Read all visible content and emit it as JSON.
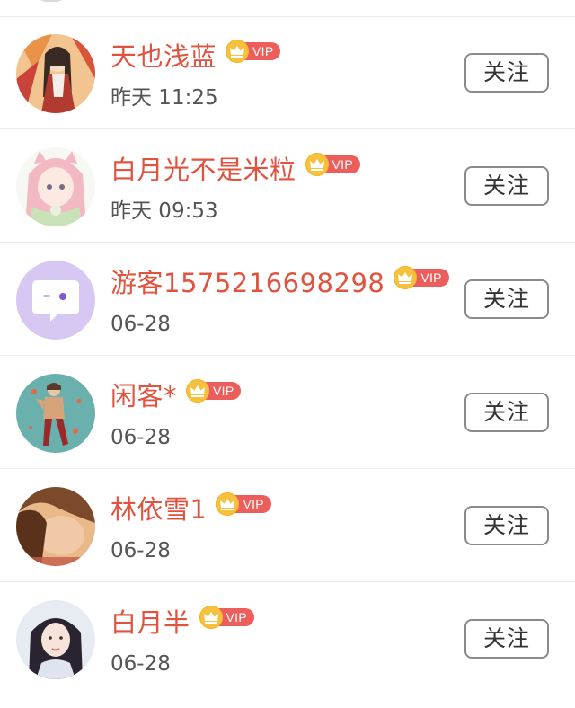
{
  "follow_label": "关注",
  "vip_label": "VIP",
  "colors": {
    "name": "#e0533f",
    "time": "#555555",
    "vip_pill": "#ec5e5b",
    "crown": "#f6c23e",
    "divider": "#ececec",
    "button_border": "#8a8a8a"
  },
  "users": [
    {
      "name": "天也浅蓝",
      "time": "昨天 11:25",
      "avatar_icon": "anime-girl-autumn-avatar"
    },
    {
      "name": "白月光不是米粒",
      "time": "昨天 09:53",
      "avatar_icon": "anime-girl-pink-hair-avatar"
    },
    {
      "name": "游客1575216698298",
      "time": "06-28",
      "avatar_icon": "default-chat-bubble-avatar"
    },
    {
      "name": "闲客*",
      "time": "06-28",
      "avatar_icon": "illustrated-figure-avatar"
    },
    {
      "name": "林依雪1",
      "time": "06-28",
      "avatar_icon": "photo-portrait-avatar"
    },
    {
      "name": "白月半",
      "time": "06-28",
      "avatar_icon": "photo-portrait-avatar"
    }
  ]
}
